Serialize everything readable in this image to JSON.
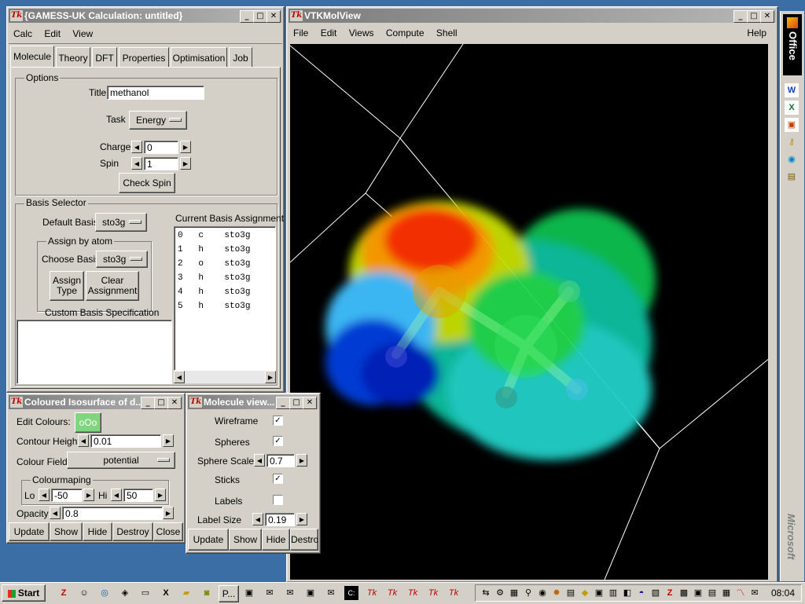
{
  "gamess_window": {
    "title": "{GAMESS-UK Calculation: untitled}",
    "menu": [
      "Calc",
      "Edit",
      "View"
    ],
    "tabs": [
      "Molecule",
      "Theory",
      "DFT",
      "Properties",
      "Optimisation",
      "Job"
    ],
    "options_label": "Options",
    "title_label": "Title",
    "title_value": "methanol",
    "task_label": "Task",
    "task_value": "Energy",
    "charge_label": "Charge",
    "charge_value": "0",
    "spin_label": "Spin",
    "spin_value": "1",
    "check_spin": "Check Spin",
    "basis_selector_label": "Basis Selector",
    "default_basis_label": "Default Basis",
    "default_basis_value": "sto3g",
    "assign_by_atom_label": "Assign by atom",
    "choose_basis_label": "Choose Basis",
    "choose_basis_value": "sto3g",
    "assign_type_line1": "Assign",
    "assign_type_line2": "Type",
    "clear_assign_line1": "Clear",
    "clear_assign_line2": "Assignment",
    "custom_basis_label": "Custom Basis Specification",
    "current_basis_label": "Current Basis Assignment",
    "basis_rows": [
      "0   c    sto3g",
      "1   h    sto3g",
      "2   o    sto3g",
      "3   h    sto3g",
      "4   h    sto3g",
      "5   h    sto3g"
    ]
  },
  "vtk_window": {
    "title": "VTKMolView",
    "menu": [
      "File",
      "Edit",
      "Views",
      "Compute",
      "Shell"
    ],
    "help": "Help"
  },
  "iso_window": {
    "title": "Coloured Isosurface of d...",
    "edit_colours_label": "Edit Colours:",
    "edit_colours_value": "oOo",
    "contour_label": "Contour Height",
    "contour_value": "0.01",
    "colour_field_label": "Colour Field:",
    "colour_field_value": "potential",
    "colourmap_label": "Colourmaping",
    "lo_label": "Lo",
    "lo_value": "-50",
    "hi_label": "Hi",
    "hi_value": "50",
    "opacity_label": "Opacity",
    "opacity_value": "0.8",
    "buttons": [
      "Update",
      "Show",
      "Hide",
      "Destroy",
      "Close"
    ]
  },
  "molview_window": {
    "title": "Molecule view...",
    "wireframe_label": "Wireframe",
    "spheres_label": "Spheres",
    "sphere_scale_label": "Sphere Scale",
    "sphere_scale_value": "0.7",
    "sticks_label": "Sticks",
    "labels_label": "Labels",
    "label_size_label": "Label Size",
    "label_size_value": "0.19",
    "wireframe_checked": true,
    "spheres_checked": true,
    "sticks_checked": true,
    "labels_checked": false,
    "buttons": [
      "Update",
      "Show",
      "Hide",
      "Destroy"
    ]
  },
  "office_bar": {
    "label": "Office",
    "vendor": "Microsoft"
  },
  "taskbar": {
    "start": "Start",
    "task_p": "P...",
    "clock": "08:04"
  },
  "colors": {
    "desktop": "#3a6ea5",
    "window_face": "#d4d0c8",
    "accent_green": "#7fd67f"
  }
}
